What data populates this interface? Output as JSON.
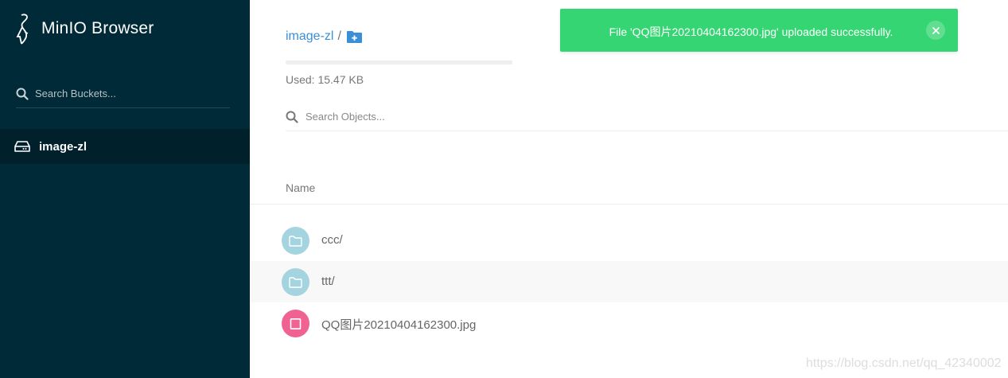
{
  "sidebar": {
    "brand": "MinIO Browser",
    "bucket_search": {
      "placeholder": "Search Buckets..."
    },
    "buckets": [
      {
        "name": "image-zl"
      }
    ]
  },
  "main": {
    "breadcrumb": {
      "bucket": "image-zl",
      "separator": "/"
    },
    "usage": {
      "text": "Used: 15.47 KB",
      "fraction": 0
    },
    "object_search": {
      "placeholder": "Search Objects..."
    },
    "columns": {
      "name": "Name"
    },
    "objects": [
      {
        "name": "ccc/",
        "type": "folder"
      },
      {
        "name": "ttt/",
        "type": "folder"
      },
      {
        "name": "QQ图片20210404162300.jpg",
        "type": "file"
      }
    ]
  },
  "toast": {
    "message": "File 'QQ图片20210404162300.jpg' uploaded successfully.",
    "color": "#36d573"
  },
  "watermark": "https://blog.csdn.net/qq_42340002",
  "colors": {
    "sidebar_bg": "#002a37",
    "link": "#3a8fd6",
    "folder_icon": "#a4d4e0",
    "file_icon": "#f06292"
  },
  "icons": {
    "brand": "minio-bird-icon",
    "search": "search-icon",
    "bucket": "hard-drive-icon",
    "add_folder": "folder-plus-icon",
    "folder": "folder-icon",
    "file": "file-icon",
    "close": "close-icon"
  }
}
